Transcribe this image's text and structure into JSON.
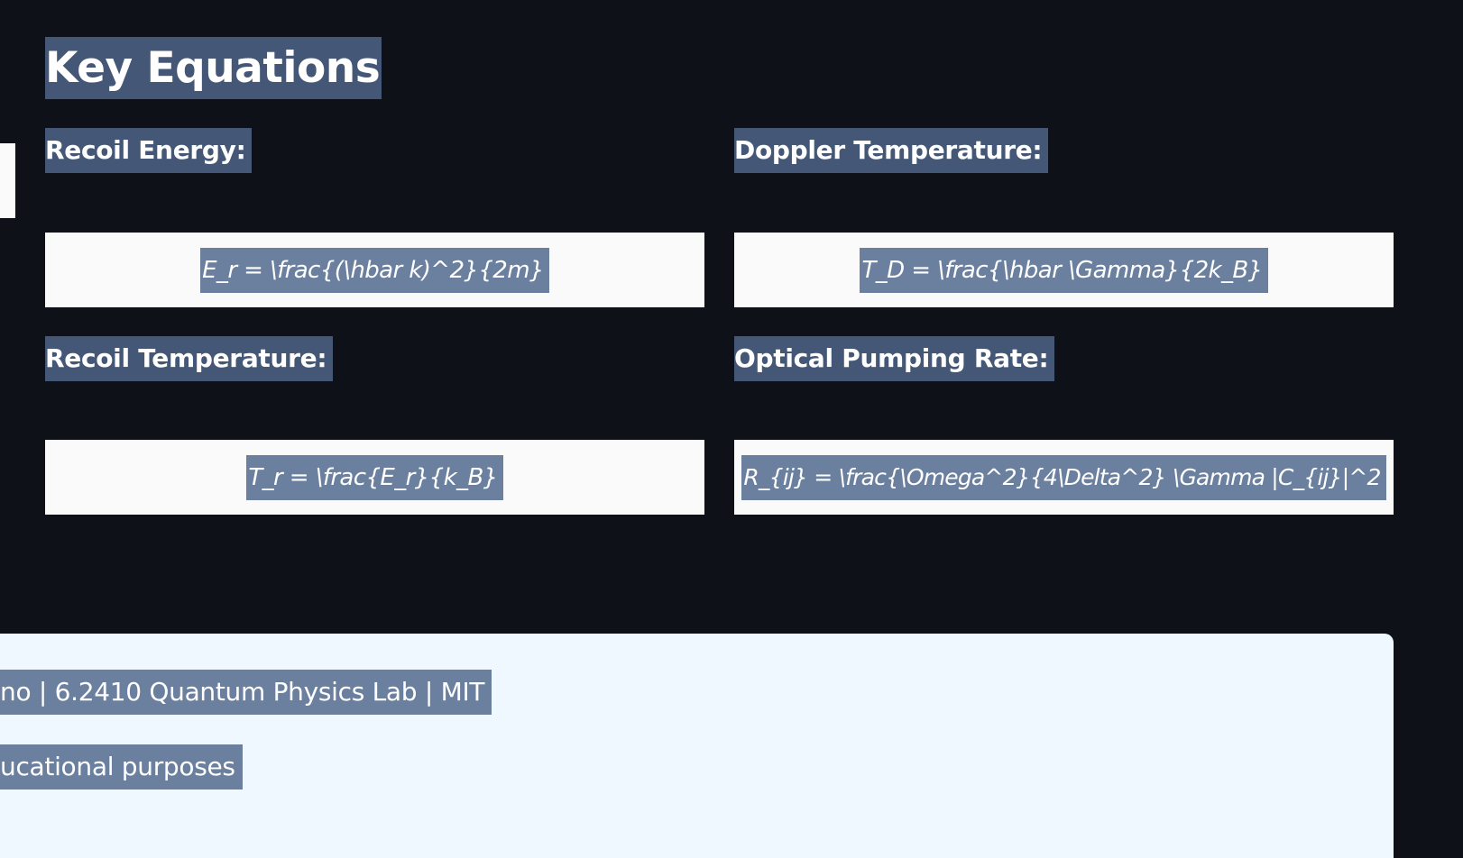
{
  "section": {
    "title": "Key Equations"
  },
  "equations": [
    {
      "label": "Recoil Energy:",
      "formula": "E_r = \\frac{(\\hbar k)^2}{2m}"
    },
    {
      "label": "Doppler Temperature:",
      "formula": "T_D = \\frac{\\hbar \\Gamma}{2k_B}"
    },
    {
      "label": "Recoil Temperature:",
      "formula": "T_r = \\frac{E_r}{k_B}"
    },
    {
      "label": "Optical Pumping Rate:",
      "formula": "R_{ij} = \\frac{\\Omega^2}{4\\Delta^2} \\Gamma |C_{ij}|^2"
    }
  ],
  "footer": {
    "line1": "no | 6.2410 Quantum Physics Lab | MIT",
    "line2": "ucational purposes"
  },
  "colors": {
    "background": "#0e1117",
    "selection_dark": "#445776",
    "selection_light": "#6b809f",
    "equation_box": "#fafafa",
    "footer_background": "#f0f8ff"
  }
}
